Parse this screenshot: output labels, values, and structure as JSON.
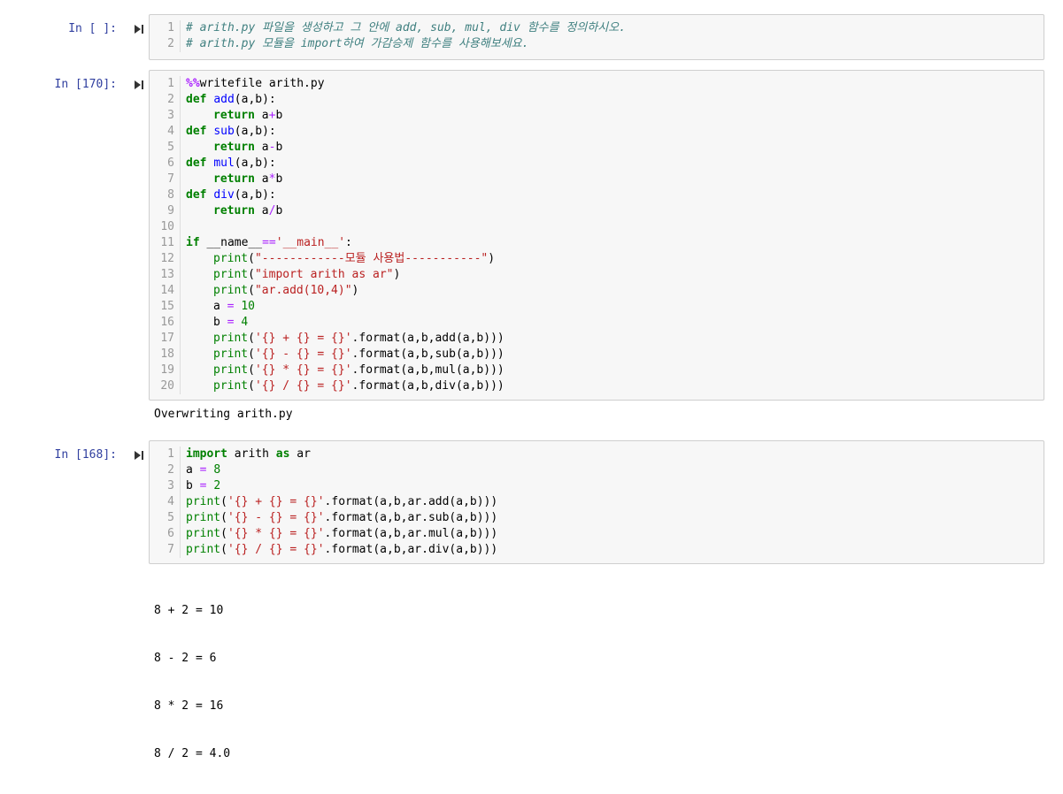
{
  "cells": [
    {
      "prompt": "In [ ]:",
      "lines": [
        "# arith.py 파일을 생성하고 그 안에 add, sub, mul, div 함수를 정의하시오.",
        "# arith.py 모듈을 import하여 가감승제 함수를 사용해보세요."
      ]
    },
    {
      "prompt": "In [170]:",
      "code": {
        "magic": "%%",
        "writefile": "writefile arith.py",
        "def": "def",
        "ret": "return",
        "if": "if",
        "add": "add",
        "sub": "sub",
        "mul": "mul",
        "div": "div",
        "params": "(a,b):",
        "a": "a",
        "b": "b",
        "plus": "+",
        "minus": "-",
        "star": "*",
        "slash": "/",
        "name_var": "__name__",
        "eqeq": "==",
        "main_str": "'__main__'",
        "colon": ":",
        "print": "print",
        "lp": "(",
        "rp": ")",
        "s1": "\"------------모듈 사용법-----------\"",
        "s2": "\"import arith as ar\"",
        "s3": "\"ar.add(10,4)\"",
        "a_eq": "a ",
        "b_eq": "b ",
        "eq": "=",
        "ten": "10",
        "four": "4",
        "f_add": "'{} + {} = {}'",
        "f_sub": "'{} - {} = {}'",
        "f_mul": "'{} * {} = {}'",
        "f_div": "'{} / {} = {}'",
        "t_add": ".format(a,b,add(a,b)))",
        "t_sub": ".format(a,b,sub(a,b)))",
        "t_mul": ".format(a,b,mul(a,b)))",
        "t_div": ".format(a,b,div(a,b)))"
      },
      "output": "Overwriting arith.py"
    },
    {
      "prompt": "In [168]:",
      "code": {
        "import": "import",
        "module": " arith ",
        "as": "as",
        "alias": " ar",
        "a_eq": "a ",
        "b_eq": "b ",
        "eq": "=",
        "eight": "8",
        "two": "2",
        "print": "print",
        "lp": "(",
        "f_add": "'{} + {} = {}'",
        "f_sub": "'{} - {} = {}'",
        "f_mul": "'{} * {} = {}'",
        "f_div": "'{} / {} = {}'",
        "t_add": ".format(a,b,ar.add(a,b)))",
        "t_sub": ".format(a,b,ar.sub(a,b)))",
        "t_mul": ".format(a,b,ar.mul(a,b)))",
        "t_div": ".format(a,b,ar.div(a,b)))"
      },
      "output": [
        "8 + 2 = 10",
        "8 - 2 = 6",
        "8 * 2 = 16",
        "8 / 2 = 4.0"
      ]
    }
  ]
}
